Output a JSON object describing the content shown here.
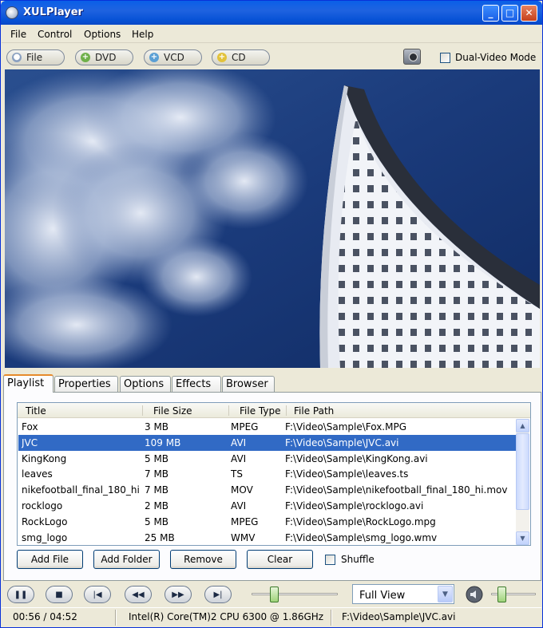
{
  "window": {
    "title": "XULPlayer",
    "min_glyph": "_",
    "max_glyph": "□",
    "close_glyph": "✕"
  },
  "menu": [
    "File",
    "Control",
    "Options",
    "Help"
  ],
  "toolbar": {
    "buttons": [
      {
        "label": "File",
        "icon": "disc-icon",
        "glyph": "●",
        "color": "#8aa0c0"
      },
      {
        "label": "DVD",
        "icon": "plus-icon",
        "glyph": "+",
        "color": "#6fb04a"
      },
      {
        "label": "VCD",
        "icon": "plus-icon",
        "glyph": "+",
        "color": "#5a9fd4"
      },
      {
        "label": "CD",
        "icon": "plus-icon",
        "glyph": "+",
        "color": "#e2c23a"
      }
    ],
    "snapshot_icon": "camera-icon",
    "dual_video_label": "Dual-Video Mode",
    "dual_video_checked": false
  },
  "tabs": [
    "Playlist",
    "Properties",
    "Options",
    "Effects",
    "Browser"
  ],
  "active_tab": 0,
  "playlist": {
    "columns": [
      "Title",
      "File Size",
      "File Type",
      "File Path"
    ],
    "rows": [
      [
        "Fox",
        "3 MB",
        "MPEG",
        "F:\\Video\\Sample\\Fox.MPG"
      ],
      [
        "JVC",
        "109 MB",
        "AVI",
        "F:\\Video\\Sample\\JVC.avi"
      ],
      [
        "KingKong",
        "5 MB",
        "AVI",
        "F:\\Video\\Sample\\KingKong.avi"
      ],
      [
        "leaves",
        "7 MB",
        "TS",
        "F:\\Video\\Sample\\leaves.ts"
      ],
      [
        "nikefootball_final_180_hi",
        "7 MB",
        "MOV",
        "F:\\Video\\Sample\\nikefootball_final_180_hi.mov"
      ],
      [
        "rocklogo",
        "2 MB",
        "AVI",
        "F:\\Video\\Sample\\rocklogo.avi"
      ],
      [
        "RockLogo",
        "5 MB",
        "MPEG",
        "F:\\Video\\Sample\\RockLogo.mpg"
      ],
      [
        "smg_logo",
        "25 MB",
        "WMV",
        "F:\\Video\\Sample\\smg_logo.wmv"
      ]
    ],
    "selected_row": 1,
    "buttons": [
      "Add File",
      "Add Folder",
      "Remove",
      "Clear"
    ],
    "shuffle_label": "Shuffle",
    "shuffle_checked": false
  },
  "controls": {
    "buttons": [
      {
        "name": "pause-button",
        "icon": "pause-icon",
        "glyph": "❚❚"
      },
      {
        "name": "stop-button",
        "icon": "stop-icon",
        "glyph": "■"
      },
      {
        "name": "previous-button",
        "icon": "skip-back-icon",
        "glyph": "|◀"
      },
      {
        "name": "rewind-button",
        "icon": "rewind-icon",
        "glyph": "◀◀"
      },
      {
        "name": "forward-button",
        "icon": "fast-forward-icon",
        "glyph": "▶▶"
      },
      {
        "name": "next-button",
        "icon": "skip-forward-icon",
        "glyph": "▶|"
      }
    ],
    "seek_position": 0.24,
    "view_mode": "Full View",
    "volume_level": 0.18
  },
  "status": {
    "time": "00:56 / 04:52",
    "cpu": "Intel(R) Core(TM)2 CPU 6300 @ 1.86GHz",
    "file": "F:\\Video\\Sample\\JVC.avi"
  }
}
